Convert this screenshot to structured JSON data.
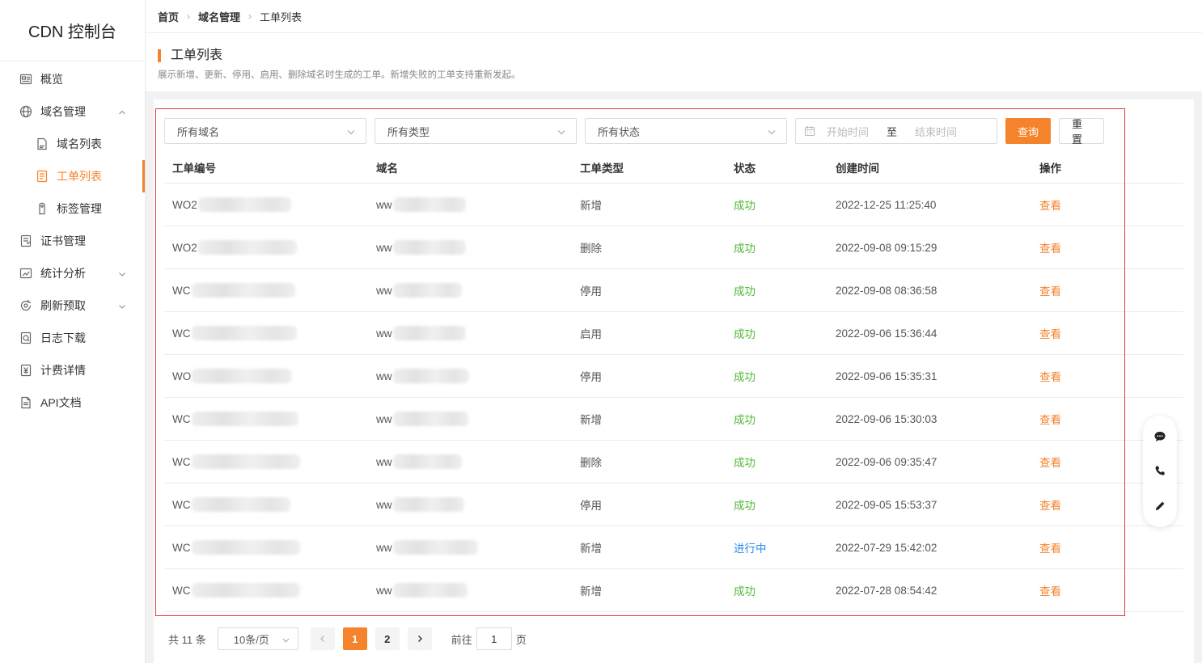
{
  "app": {
    "brand": "CDN 控制台"
  },
  "sidebar": {
    "items": [
      {
        "label": "概览",
        "icon": "overview-icon"
      },
      {
        "label": "域名管理",
        "icon": "globe-icon",
        "expanded": true
      },
      {
        "label": "域名列表",
        "icon": "domain-list-icon",
        "sub": true
      },
      {
        "label": "工单列表",
        "icon": "ticket-list-icon",
        "sub": true,
        "active": true
      },
      {
        "label": "标签管理",
        "icon": "tag-icon",
        "sub": true
      },
      {
        "label": "证书管理",
        "icon": "certificate-icon"
      },
      {
        "label": "统计分析",
        "icon": "chart-icon",
        "expandable": true
      },
      {
        "label": "刷新预取",
        "icon": "refresh-icon",
        "expandable": true
      },
      {
        "label": "日志下载",
        "icon": "log-icon"
      },
      {
        "label": "计费详情",
        "icon": "billing-icon"
      },
      {
        "label": "API文档",
        "icon": "doc-icon"
      }
    ]
  },
  "breadcrumb": {
    "home": "首页",
    "section": "域名管理",
    "current": "工单列表"
  },
  "page": {
    "title": "工单列表",
    "description": "展示新增、更新、停用、启用、删除域名时生成的工单。新增失败的工单支持重新发起。"
  },
  "filters": {
    "domain": "所有域名",
    "type": "所有类型",
    "status": "所有状态",
    "start_placeholder": "开始时间",
    "range_separator": "至",
    "end_placeholder": "结束时间",
    "query_label": "查询",
    "reset_label": "重置"
  },
  "table": {
    "headers": [
      "工单编号",
      "域名",
      "工单类型",
      "状态",
      "创建时间",
      "操作"
    ],
    "rows": [
      {
        "id": "WO2",
        "domain": "ww",
        "type": "新增",
        "status": "成功",
        "time": "2022-12-25 11:25:40",
        "action": "查看"
      },
      {
        "id": "WO2",
        "domain": "ww",
        "type": "删除",
        "status": "成功",
        "time": "2022-09-08 09:15:29",
        "action": "查看"
      },
      {
        "id": "WC",
        "domain": "ww",
        "type": "停用",
        "status": "成功",
        "time": "2022-09-08 08:36:58",
        "action": "查看"
      },
      {
        "id": "WC",
        "domain": "ww",
        "type": "启用",
        "status": "成功",
        "time": "2022-09-06 15:36:44",
        "action": "查看"
      },
      {
        "id": "WO",
        "domain": "ww",
        "type": "停用",
        "status": "成功",
        "time": "2022-09-06 15:35:31",
        "action": "查看"
      },
      {
        "id": "WC",
        "domain": "ww",
        "type": "新增",
        "status": "成功",
        "time": "2022-09-06 15:30:03",
        "action": "查看"
      },
      {
        "id": "WC",
        "domain": "ww",
        "type": "删除",
        "status": "成功",
        "time": "2022-09-06 09:35:47",
        "action": "查看"
      },
      {
        "id": "WC",
        "domain": "ww",
        "type": "停用",
        "status": "成功",
        "time": "2022-09-05 15:53:37",
        "action": "查看"
      },
      {
        "id": "WC",
        "domain": "ww",
        "type": "新增",
        "status": "进行中",
        "time": "2022-07-29 15:42:02",
        "action": "查看"
      },
      {
        "id": "WC",
        "domain": "ww",
        "type": "新增",
        "status": "成功",
        "time": "2022-07-28 08:54:42",
        "action": "查看"
      }
    ]
  },
  "pagination": {
    "total_label": "共 11 条",
    "page_size": "10条/页",
    "pages": [
      "1",
      "2"
    ],
    "current_page": "1",
    "goto_label": "前往",
    "goto_value": "1",
    "page_unit": "页"
  },
  "colors": {
    "accent": "#f5832c",
    "success": "#52b836",
    "running": "#2d8cf0",
    "highlight_box": "#e23b3b"
  }
}
